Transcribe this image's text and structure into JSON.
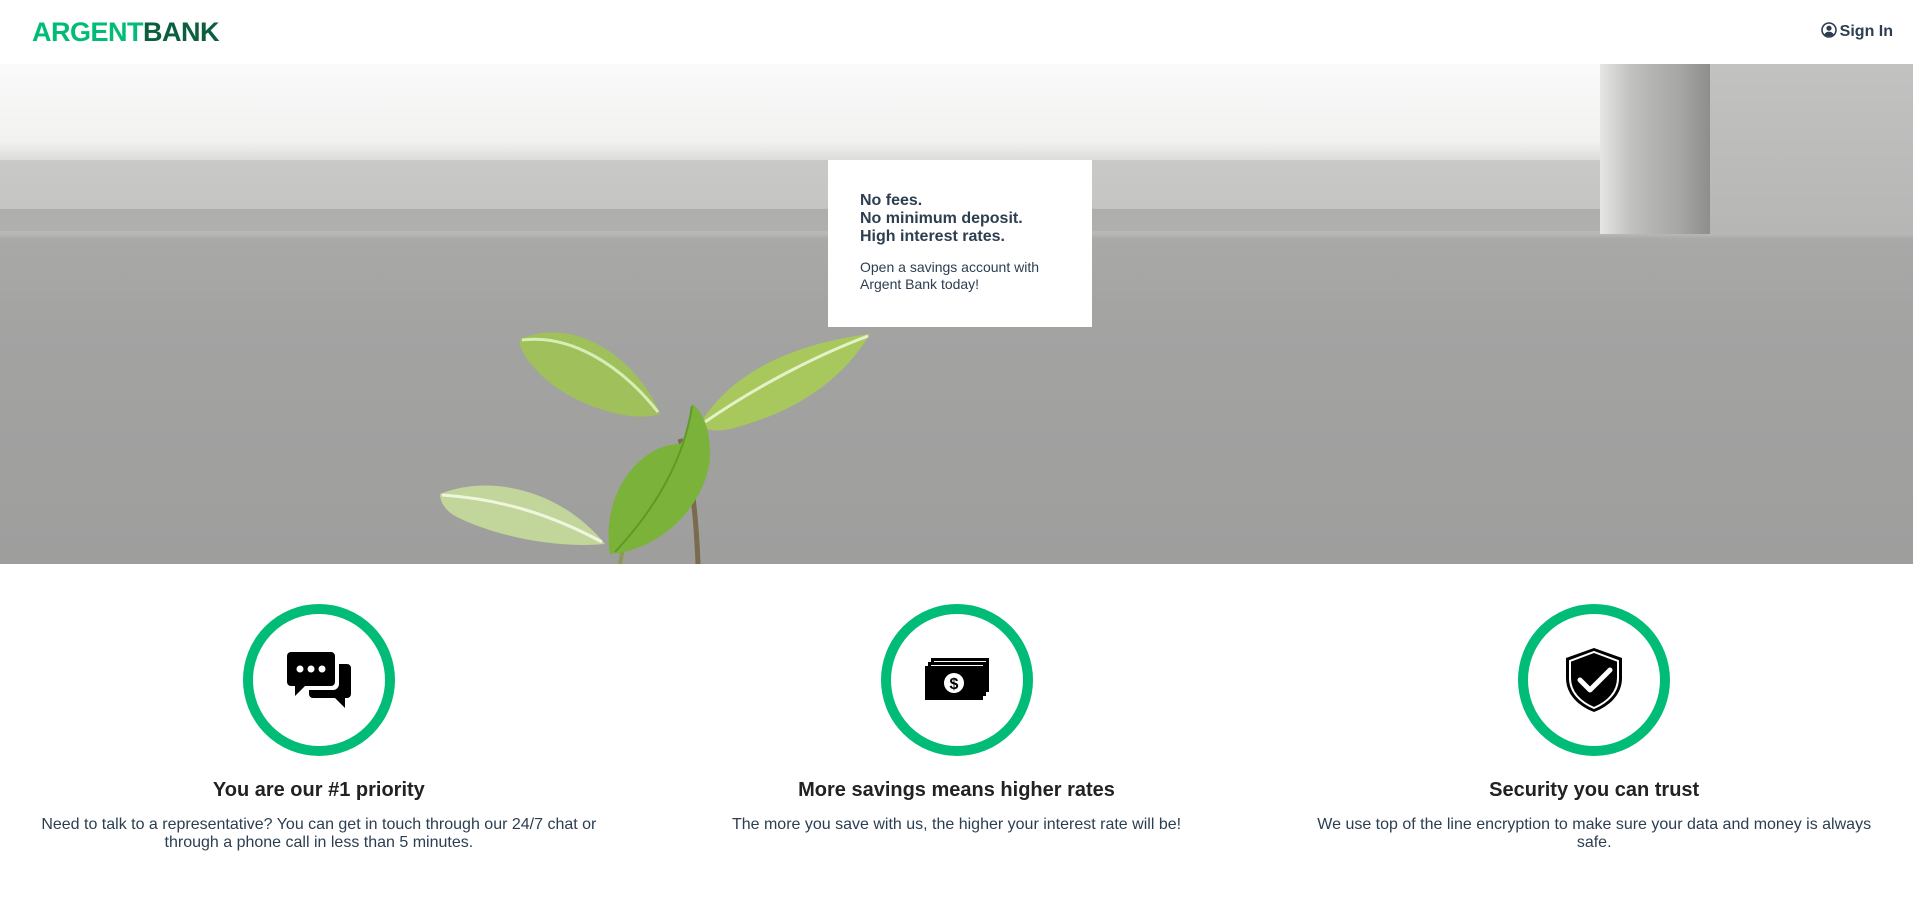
{
  "header": {
    "logo_part1": "ARGENT",
    "logo_part2": "BANK",
    "signin_label": "Sign In",
    "signin_icon": "user-circle-icon"
  },
  "hero": {
    "subtitles": [
      "No fees.",
      "No minimum deposit.",
      "High interest rates."
    ],
    "text": "Open a savings account with Argent Bank today!"
  },
  "features": [
    {
      "icon": "chat-icon",
      "title": "You are our #1 priority",
      "text": "Need to talk to a representative? You can get in touch through our 24/7 chat or through a phone call in less than 5 minutes."
    },
    {
      "icon": "money-icon",
      "title": "More savings means higher rates",
      "text": "The more you save with us, the higher your interest rate will be!"
    },
    {
      "icon": "shield-check-icon",
      "title": "Security you can trust",
      "text": "We use top of the line encryption to make sure your data and money is always safe."
    }
  ],
  "colors": {
    "accent": "#00bc77",
    "brand_dark": "#0b5e3e",
    "text": "#2c3e50"
  }
}
